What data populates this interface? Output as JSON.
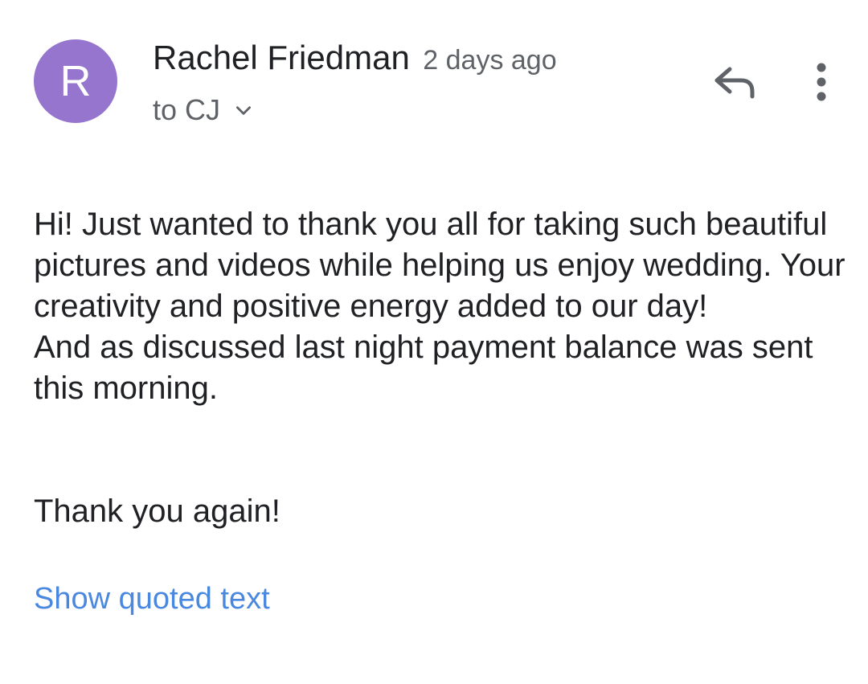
{
  "sender": {
    "avatar_letter": "R",
    "avatar_color": "#9575cd",
    "name": "Rachel Friedman",
    "time": "2 days ago"
  },
  "recipient": {
    "label": "to CJ",
    "expand_icon": "chevron-down-icon"
  },
  "actions": {
    "reply_icon": "reply-icon",
    "more_icon": "more-vert-icon"
  },
  "message": {
    "line1": "Hi! Just wanted to thank you all for taking such beautiful pictures and videos while helping us enjoy wedding. Your creativity and positive energy added to our day!",
    "line2": "And as discussed last night payment balance was sent this morning.",
    "closing": "Thank you again!"
  },
  "show_quoted_label": "Show quoted text",
  "colors": {
    "link": "#4a88e0",
    "text": "#202124",
    "secondary": "#5f6368"
  }
}
